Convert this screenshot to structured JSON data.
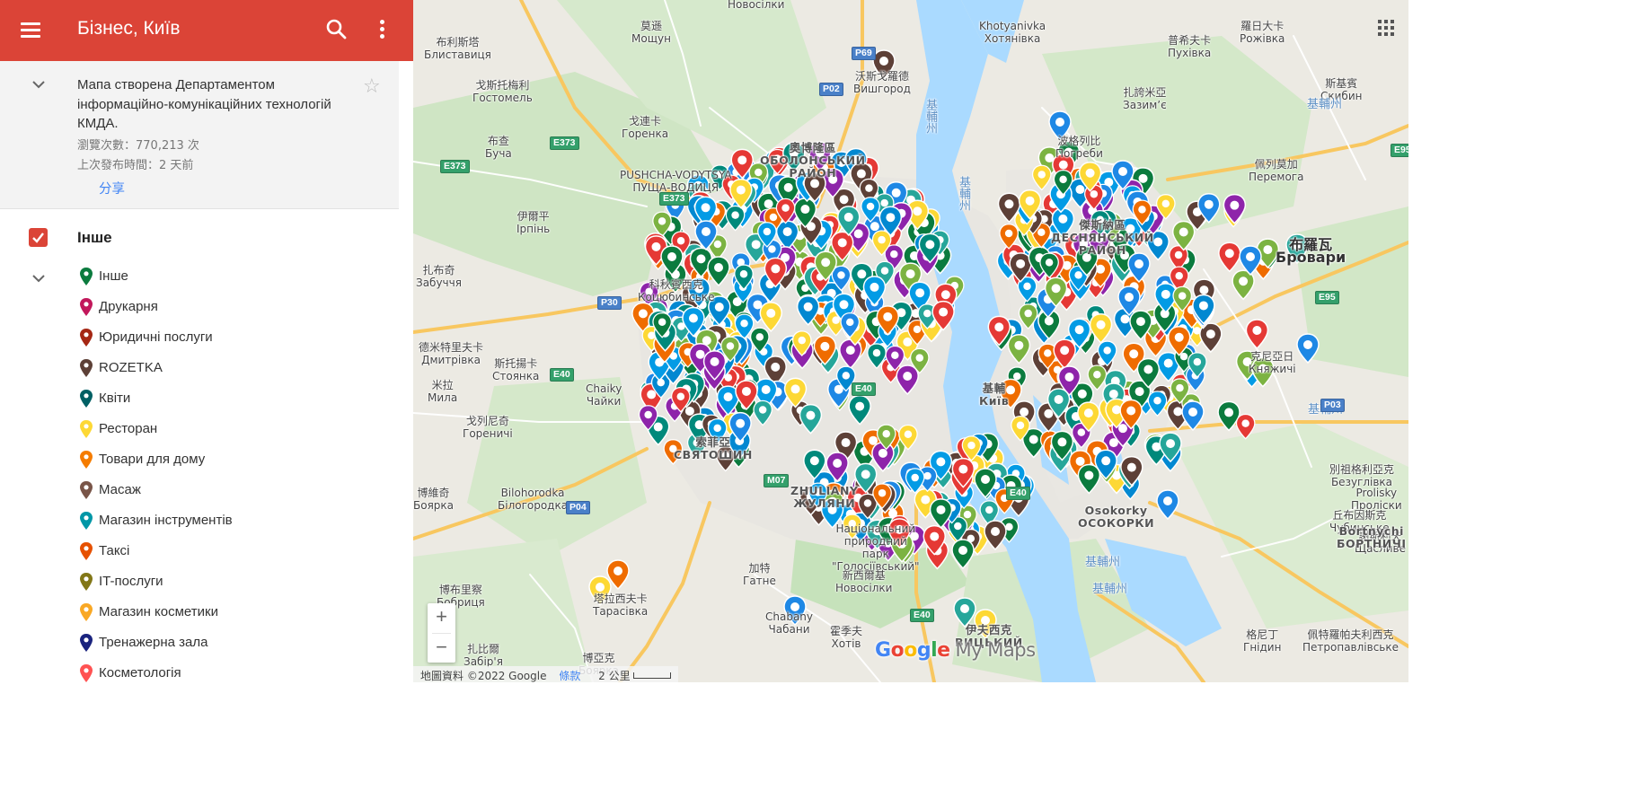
{
  "header": {
    "title": "Бізнес, Київ"
  },
  "info": {
    "description": "Мапа створена Департаментом інформаційно-комунікаційних технологій КМДА.",
    "views": "瀏覽次數：770,213 次",
    "published": "上次發布時間：2 天前",
    "share": "分享"
  },
  "layer": {
    "name": "Інше",
    "checked": true
  },
  "legend": [
    {
      "label": "Інше",
      "color": "#0b7b3e"
    },
    {
      "label": "Друкарня",
      "color": "#c2185b"
    },
    {
      "label": "Юридичні послуги",
      "color": "#a52714"
    },
    {
      "label": "ROZETKA",
      "color": "#5d4037"
    },
    {
      "label": "Квіти",
      "color": "#006064"
    },
    {
      "label": "Ресторан",
      "color": "#fdd835"
    },
    {
      "label": "Товари для дому",
      "color": "#f57c00"
    },
    {
      "label": "Масаж",
      "color": "#795548"
    },
    {
      "label": "Магазин інструментів",
      "color": "#0097a7"
    },
    {
      "label": "Таксі",
      "color": "#e65100"
    },
    {
      "label": "IT-послуги",
      "color": "#827717"
    },
    {
      "label": "Магазин косметики",
      "color": "#f9a825"
    },
    {
      "label": "Тренажерна зала",
      "color": "#1a237e"
    },
    {
      "label": "Косметологія",
      "color": "#ff5252"
    }
  ],
  "map": {
    "labels": [
      {
        "text": "莫遜\nМощун"
      },
      {
        "text": "Новосілки"
      },
      {
        "text": "Khotyanivka\nХотянівка"
      },
      {
        "text": "羅日大卡\nРожівка"
      },
      {
        "text": "普希夫卡\nПухівка"
      },
      {
        "text": "布利斯塔\nБлиставиця"
      },
      {
        "text": "沃斯戈羅德\nВишгород"
      },
      {
        "text": "戈斯托梅利\nГостомель"
      },
      {
        "text": "扎誇米亞\nЗазимʼє"
      },
      {
        "text": "斯基賓\nСкибин"
      },
      {
        "text": "戈連卡\nГоренка"
      },
      {
        "text": "布查\nБуча"
      },
      {
        "text": "奧博隆區\nОБОЛОНСЬКИЙ\nРАЙОН"
      },
      {
        "text": "波格列比\nПогреби"
      },
      {
        "text": "佩列莫加\nПеремога"
      },
      {
        "text": "PUSHCHA-VODYTSYA\nПУЩА-ВОДИЦЯ"
      },
      {
        "text": "伊爾平\nІрпінь"
      },
      {
        "text": "傑斯納區\nДЕСНЯНСЬКИЙ\nРАЙОН"
      },
      {
        "text": "布羅瓦\nБровари"
      },
      {
        "text": "扎布奇\nЗабуччя"
      },
      {
        "text": "科秋賓西克\nКоцюбинське"
      },
      {
        "text": "德米特里夫卡\nДмитрівка"
      },
      {
        "text": "斯托揚卡\nСтоянка"
      },
      {
        "text": "米拉\nМила"
      },
      {
        "text": "Chaiky\nЧайки"
      },
      {
        "text": "基輔\nКиїв"
      },
      {
        "text": "克尼亞日\nКняжичі"
      },
      {
        "text": "戈列尼奇\nГореничі"
      },
      {
        "text": "博維奇\nБоярка"
      },
      {
        "text": "Bilohorodka\nБілогородка"
      },
      {
        "text": "Prolisky\nПроліски"
      },
      {
        "text": "別祖格利亞克\nБезуглівка"
      },
      {
        "text": "丘布因斯克\nЧубинське"
      },
      {
        "text": "謝斯利夫\nЩасливе"
      },
      {
        "text": "加特\nГатне"
      },
      {
        "text": "Національний\nприродний\nпарк\n\"Голосіївський\""
      },
      {
        "text": "新西爾基\nНовосілки"
      },
      {
        "text": "博布里察\nБобриця"
      },
      {
        "text": "塔拉西夫卡\nТарасівка"
      },
      {
        "text": "扎比爾\nЗабір'я"
      },
      {
        "text": "霍季夫\nХотів"
      },
      {
        "text": "Chabany\nЧабани"
      },
      {
        "text": "格尼丁\nГнідин"
      },
      {
        "text": "佩特羅帕夫利西克\nПетропавлівське"
      },
      {
        "text": "博亞克\nБоярка"
      },
      {
        "text": "伊夫西克\nВИЦЬКИЙ"
      },
      {
        "text": "Bortnychi\nБОРТНИЧІ"
      },
      {
        "text": "Osokorky\nОСОКОРКИ"
      },
      {
        "text": "ZHULIANY\nЖУЛЯНИ"
      },
      {
        "text": "索菲亞\nСВЯТОШИН"
      }
    ],
    "rivers": [
      "基輔州",
      "基輔州",
      "基輔州",
      "基輔州",
      "基輔州",
      "基輔州"
    ],
    "road_shields": [
      "P69",
      "P02",
      "E373",
      "E373",
      "E373",
      "P30",
      "E40",
      "E40",
      "M07",
      "P04",
      "E40",
      "E95",
      "E95",
      "P03",
      "E40"
    ],
    "attribution": "地圖資料 ©2022 Google",
    "terms": "條款",
    "scale": "2 公里",
    "logo_google": "Google",
    "logo_mymaps": "My Maps"
  },
  "zoom": {
    "in": "+",
    "out": "−"
  },
  "colors": {
    "header": "#db4437",
    "water": "#aadaff",
    "park": "#c8e6c9",
    "land": "#f2f1ec",
    "road_major": "#fbd36b",
    "road_minor": "#ffffff",
    "share_link": "#4285f4"
  },
  "icons": {
    "menu": "hamburger-icon",
    "search": "search-icon",
    "more": "more-vert-icon",
    "collapse": "chevron-down-icon",
    "star": "star-outline-icon",
    "layer_checkbox": "checkbox-checked-icon",
    "apps": "apps-grid-icon"
  }
}
